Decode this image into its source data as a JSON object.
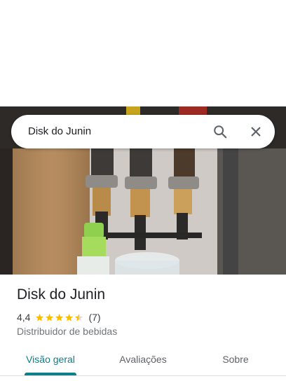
{
  "search": {
    "query": "Disk do Junin",
    "search_icon": "search-icon",
    "close_icon": "close-icon"
  },
  "place": {
    "name": "Disk do Junin",
    "rating": "4,4",
    "stars": 4.4,
    "reviews": "(7)",
    "category": "Distribuidor de bebidas"
  },
  "tabs": [
    {
      "label": "Visão geral",
      "active": true
    },
    {
      "label": "Avaliações",
      "active": false
    },
    {
      "label": "Sobre",
      "active": false
    }
  ],
  "colors": {
    "accent": "#0b7f8a",
    "star": "#fbbc04"
  }
}
